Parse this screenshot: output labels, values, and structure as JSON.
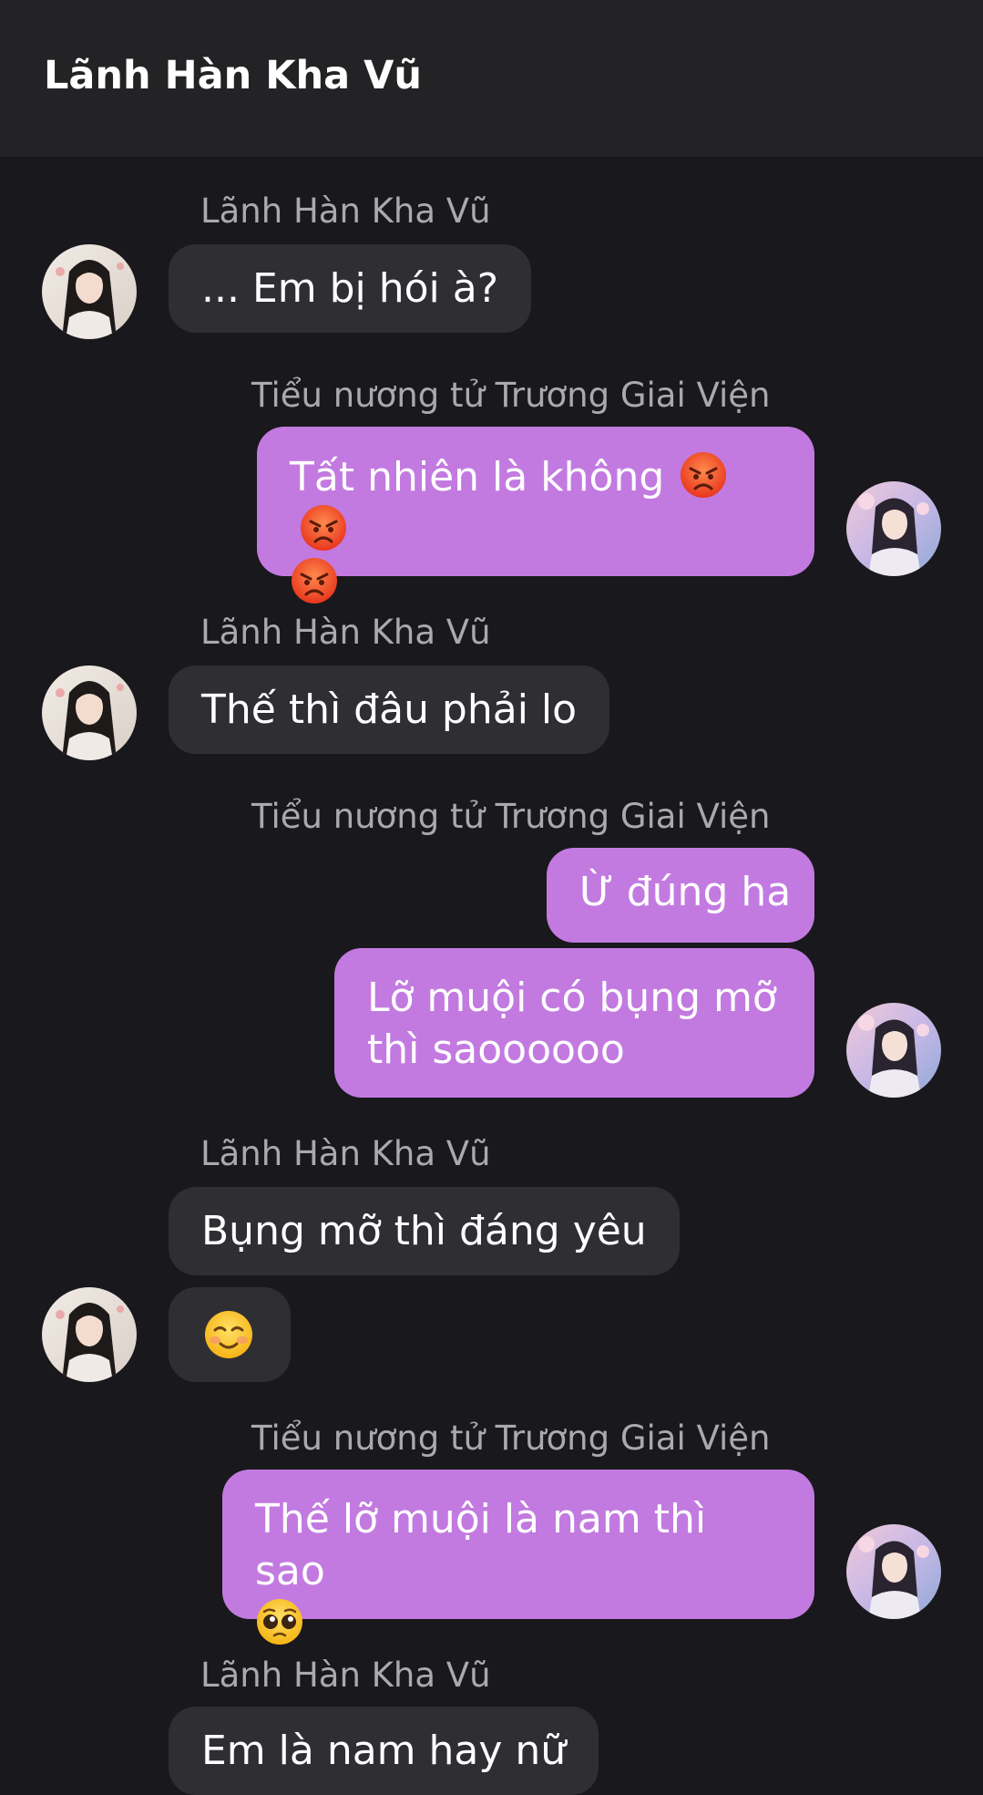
{
  "header": {
    "title": "Lãnh Hàn Kha Vũ"
  },
  "contacts": {
    "left_name": "Lãnh Hàn Kha Vũ",
    "right_name": "Tiểu nương tử Trương Giai Viện"
  },
  "messages": [
    {
      "from": "left",
      "text": "... Em bị hói à?"
    },
    {
      "from": "right",
      "text": "Tất nhiên là không",
      "emoji": [
        "angry-face",
        "angry-face",
        "angry-face"
      ]
    },
    {
      "from": "left",
      "text": "Thế thì đâu phải lo"
    },
    {
      "from": "right",
      "text": "Ừ đúng ha"
    },
    {
      "from": "right",
      "text_line1": "Lỡ muội có bụng mỡ",
      "text_line2": "thì saoooooo"
    },
    {
      "from": "left",
      "text": "Bụng mỡ thì đáng yêu"
    },
    {
      "from": "left",
      "emoji": "smiling-face"
    },
    {
      "from": "right",
      "text": "Thế lỡ muội là nam thì sao",
      "emoji": "pleading-face"
    },
    {
      "from": "left",
      "text": "Em là nam hay nữ"
    }
  ],
  "colors": {
    "background": "#19181c",
    "header": "#232325",
    "incoming_bubble": "#2f2e33",
    "outgoing_bubble": "#c27ae0",
    "sender_name": "#a9a9ae"
  },
  "icons": {
    "angry": "angry-face-emoji",
    "smiling": "smiling-face-emoji",
    "pleading": "pleading-face-emoji"
  }
}
